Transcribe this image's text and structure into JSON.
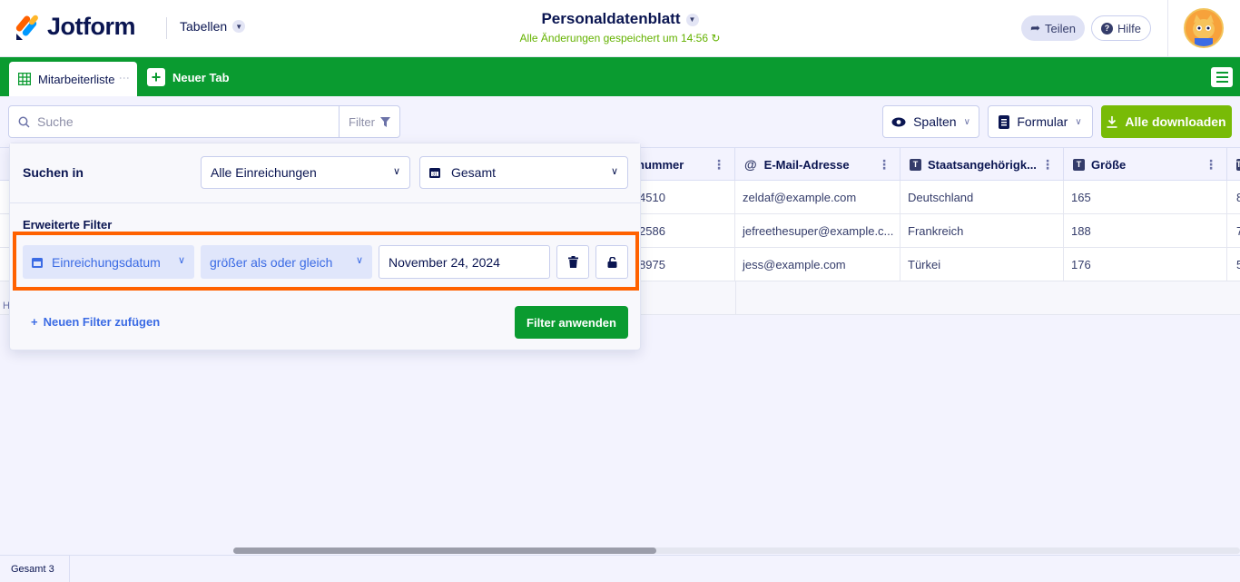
{
  "app": {
    "brand": "Jotform",
    "section": "Tabellen",
    "title": "Personaldatenblatt",
    "saved_status": "Alle Änderungen gespeichert um 14:56",
    "share_label": "Teilen",
    "help_label": "Hilfe"
  },
  "tabs": {
    "active": "Mitarbeiterliste",
    "new_tab": "Neuer Tab"
  },
  "toolbar": {
    "search_placeholder": "Suche",
    "filter_label": "Filter",
    "columns_label": "Spalten",
    "form_label": "Formular",
    "download_label": "Alle downloaden"
  },
  "table": {
    "columns": [
      "nummer",
      "E-Mail-Adresse",
      "Staatsangehörigk...",
      "Größe"
    ],
    "rows": [
      [
        "4510",
        "zeldaf@example.com",
        "Deutschland",
        "165",
        "8"
      ],
      [
        "2586",
        "jefreethesuper@example.c...",
        "Frankreich",
        "188",
        "7"
      ],
      [
        "8975",
        "jess@example.com",
        "Türkei",
        "176",
        "5"
      ]
    ],
    "left_stub": "H"
  },
  "filter_panel": {
    "search_in_label": "Suchen in",
    "submissions_select": "Alle Einreichungen",
    "scope_select": "Gesamt",
    "advanced_label": "Erweiterte Filter",
    "field_select": "Einreichungsdatum",
    "operator_select": "größer als oder gleich",
    "date_value": "November 24, 2024",
    "add_filter_label": "Neuen Filter zufügen",
    "apply_label": "Filter anwenden",
    "highlight_color": "#ff6100"
  },
  "footer": {
    "total": "Gesamt 3"
  },
  "colors": {
    "brand_green": "#0a9b30",
    "download_green": "#78bb07",
    "navy": "#0a1551",
    "link_blue": "#3b6be4"
  }
}
